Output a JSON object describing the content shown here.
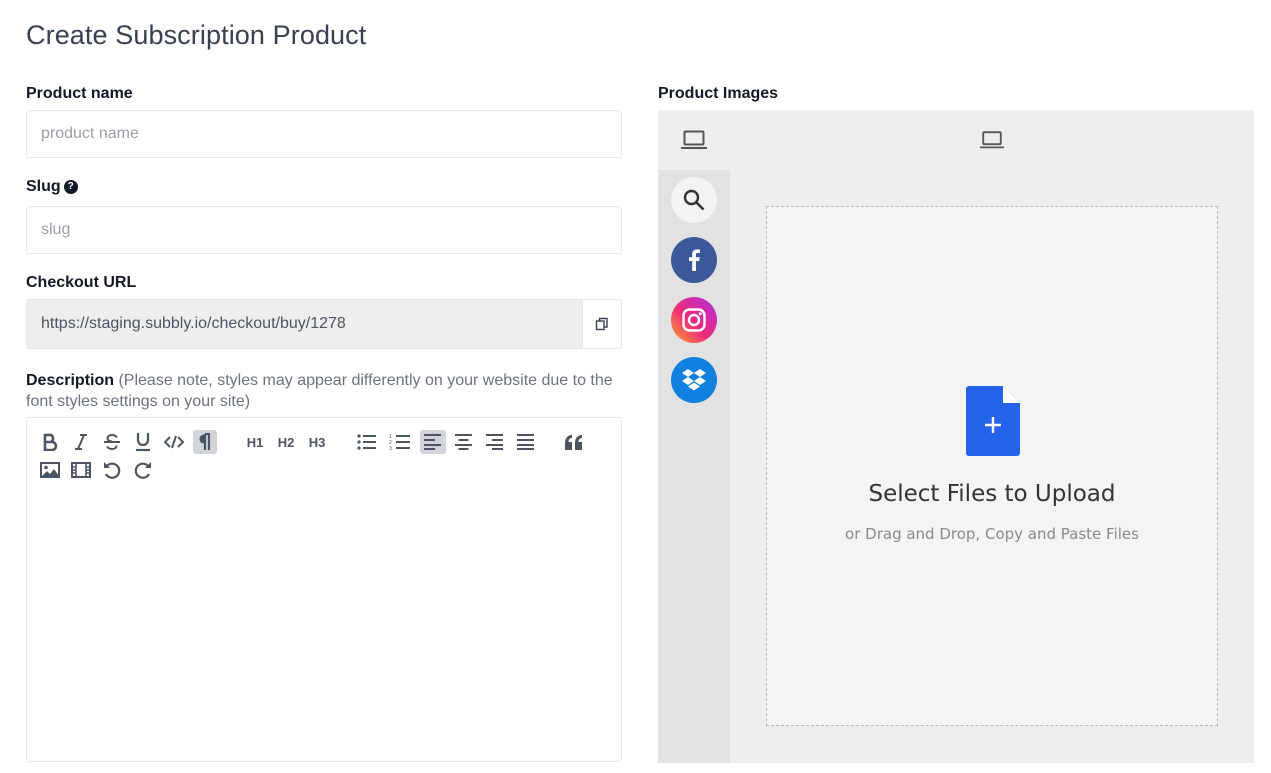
{
  "page": {
    "title": "Create Subscription Product"
  },
  "product_name": {
    "label": "Product name",
    "placeholder": "product name",
    "value": ""
  },
  "slug": {
    "label": "Slug",
    "placeholder": "slug",
    "value": "",
    "help_icon": "question-circle-icon"
  },
  "checkout_url": {
    "label": "Checkout URL",
    "value": "https://staging.subbly.io/checkout/buy/1278",
    "copy_icon": "copy-icon"
  },
  "description": {
    "label": "Description",
    "note": " (Please note, styles may appear differently on your website due to the font styles settings on your site)",
    "toolbar": {
      "h1": "H1",
      "h2": "H2",
      "h3": "H3",
      "buttons": [
        "bold",
        "italic",
        "strikethrough",
        "underline",
        "code",
        "paragraph",
        "h1",
        "h2",
        "h3",
        "bullet-list",
        "numbered-list",
        "align-left",
        "align-center",
        "align-right",
        "align-justify",
        "blockquote",
        "image",
        "video",
        "undo",
        "redo"
      ],
      "active": [
        "paragraph",
        "align-left"
      ]
    }
  },
  "product_images": {
    "label": "Product Images",
    "sources": [
      "search",
      "facebook",
      "instagram",
      "dropbox"
    ],
    "drop_title": "Select Files to Upload",
    "drop_subtitle": "or Drag and Drop, Copy and Paste Files",
    "colors": {
      "facebook": "#3b5998",
      "dropbox": "#1081de",
      "upload_file": "#2563eb"
    }
  }
}
